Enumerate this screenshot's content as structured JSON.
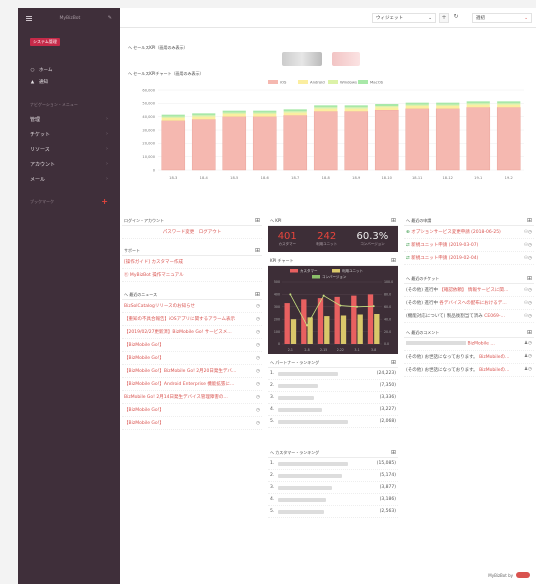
{
  "sidebar": {
    "title": "MyBizBot",
    "badge": "システム管理",
    "items": [
      {
        "icon": "○",
        "label": "ホーム"
      },
      {
        "icon": "▲",
        "label": "通知"
      }
    ],
    "section": "ナビゲーション・メニュー",
    "nav": [
      {
        "label": "管理"
      },
      {
        "label": "チケット"
      },
      {
        "label": "リソース"
      },
      {
        "label": "アカウント"
      },
      {
        "label": "メール"
      }
    ],
    "bookmark": "ブックマーク"
  },
  "topbar": {
    "widget_select": "ウィジェット",
    "add_btn": "+",
    "refresh_btn": "↻",
    "period_select": "週初"
  },
  "kpi_section": {
    "title": "へ セールスKPI（画用のみ表示）"
  },
  "chart_section": {
    "title": "へ セールスKPIチャート（画用のみ表示）"
  },
  "chart_data": {
    "type": "bar",
    "categories": [
      "18-3",
      "18-4",
      "18-5",
      "18-6",
      "18-7",
      "18-8",
      "18-9",
      "18-10",
      "18-11",
      "18-12",
      "19-1",
      "19-2"
    ],
    "series": [
      {
        "name": "iOS",
        "color": "#f5b8b0",
        "values": [
          37000,
          38000,
          40000,
          40000,
          41000,
          44000,
          44000,
          45000,
          46000,
          46000,
          47000,
          47000
        ]
      },
      {
        "name": "Android",
        "color": "#fbeea0",
        "values": [
          2000,
          2000,
          2000,
          2000,
          2000,
          2000,
          2000,
          2000,
          2000,
          2000,
          2000,
          2000
        ]
      },
      {
        "name": "Windows",
        "color": "#dcf2a8",
        "values": [
          1000,
          1000,
          1000,
          1000,
          1000,
          1000,
          1000,
          1000,
          1000,
          1000,
          1000,
          1000
        ]
      },
      {
        "name": "MacOS",
        "color": "#a8e8a8",
        "values": [
          1500,
          1500,
          1500,
          1500,
          1500,
          1500,
          1500,
          1500,
          1500,
          1500,
          1500,
          1500
        ]
      }
    ],
    "yticks": [
      "0",
      "10,000",
      "20,000",
      "30,000",
      "40,000",
      "50,000",
      "60,000"
    ],
    "ylim": [
      0,
      60000
    ]
  },
  "login": {
    "title": "ログイン・アカウント",
    "links": "パスワード変更　ログアウト"
  },
  "support": {
    "title": "サポート",
    "links": [
      "[操作ガイド] カスタマー作成",
      "⑪ MyBizBot 操作マニュアル"
    ]
  },
  "news": {
    "title": "へ 最近のニュース",
    "items": [
      "BizSolCatalogリリースのお知らせ",
      "【重知の不具合報告】iOSアプリに関するアラーム表示",
      "【2019/02/27更新済】BizMobile Go! サービスメ…",
      "【BizMobile Go!】",
      "【BizMobile Go!】",
      "【BizMobile Go!】BizMobile Go! 2月20日発生デバ…",
      "【BizMobile Go!】Android Enterprise 機能拡張に…",
      "BizMobile Go! 2月14日発生デバイス管理障害の…",
      "【BizMobile Go!】",
      "【BizMobile Go!】"
    ]
  },
  "kpi": {
    "title": "へ KPI",
    "values": [
      {
        "num": "401",
        "label": "カスタマー",
        "color": "#e8453c"
      },
      {
        "num": "242",
        "label": "利用ユニット",
        "color": "#e8453c"
      },
      {
        "num": "60.3%",
        "label": "コンバージョン",
        "color": "#e8e8e8"
      }
    ]
  },
  "kpi_chart": {
    "title": "KPI チャート",
    "legend": [
      "カスタマー",
      "利用ユニット",
      "コンバージョン"
    ],
    "ticks": [
      "0",
      "100",
      "200",
      "300",
      "400",
      "500"
    ],
    "right_ticks": [
      "0.0",
      "20.0",
      "40.0",
      "60.0",
      "80.0",
      "100.0"
    ],
    "x": [
      "2-1",
      "2-8",
      "2-15",
      "2-22",
      "3-1",
      "3-8"
    ]
  },
  "partner_rank": {
    "title": "へ パートナー・ランキング",
    "rows": [
      {
        "n": "1.",
        "v": "(24,223)"
      },
      {
        "n": "2.",
        "v": "(7,350)"
      },
      {
        "n": "3.",
        "v": "(3,336)"
      },
      {
        "n": "4.",
        "v": "(3,227)"
      },
      {
        "n": "5.",
        "v": "(2,068)"
      }
    ]
  },
  "customer_rank": {
    "title": "へ カスタマー・ランキング",
    "rows": [
      {
        "n": "1.",
        "v": "(15,085)"
      },
      {
        "n": "2.",
        "v": "(5,174)"
      },
      {
        "n": "3.",
        "v": "(3,877)"
      },
      {
        "n": "4.",
        "v": "(3,186)"
      },
      {
        "n": "5.",
        "v": "(2,563)"
      }
    ]
  },
  "requests": {
    "title": "へ 最近の申請",
    "items": [
      {
        "icon": "⊕",
        "text": "オプションサービス変更申請 (2018-06-25)"
      },
      {
        "icon": "⇄",
        "text": "新規ユニット申請 (2019-03-07)"
      },
      {
        "icon": "⇄",
        "text": "新規ユニット申請 (2019-02-04)"
      }
    ]
  },
  "tickets": {
    "title": "へ 最近のチケット",
    "items": [
      {
        "prefix": "(その他) 進行中",
        "text": "【確認依頼】 情報サービスに関…"
      },
      {
        "prefix": "(その他) 進行中",
        "text": "各デバイスへの配布におけるデ…"
      },
      {
        "prefix": "(機能対応について) 製品後割当て済み",
        "text": "CE069-…"
      }
    ]
  },
  "comments": {
    "title": "へ 最近のコメント",
    "items": [
      {
        "prefix": "",
        "text": "BizMobile …"
      },
      {
        "prefix": "(その他) お世話になっております。",
        "text": "BizMobileの…"
      },
      {
        "prefix": "(その他) お世話になっております。",
        "text": "BizMobileの…"
      }
    ]
  },
  "footer": {
    "text": "MyBizBot by"
  }
}
